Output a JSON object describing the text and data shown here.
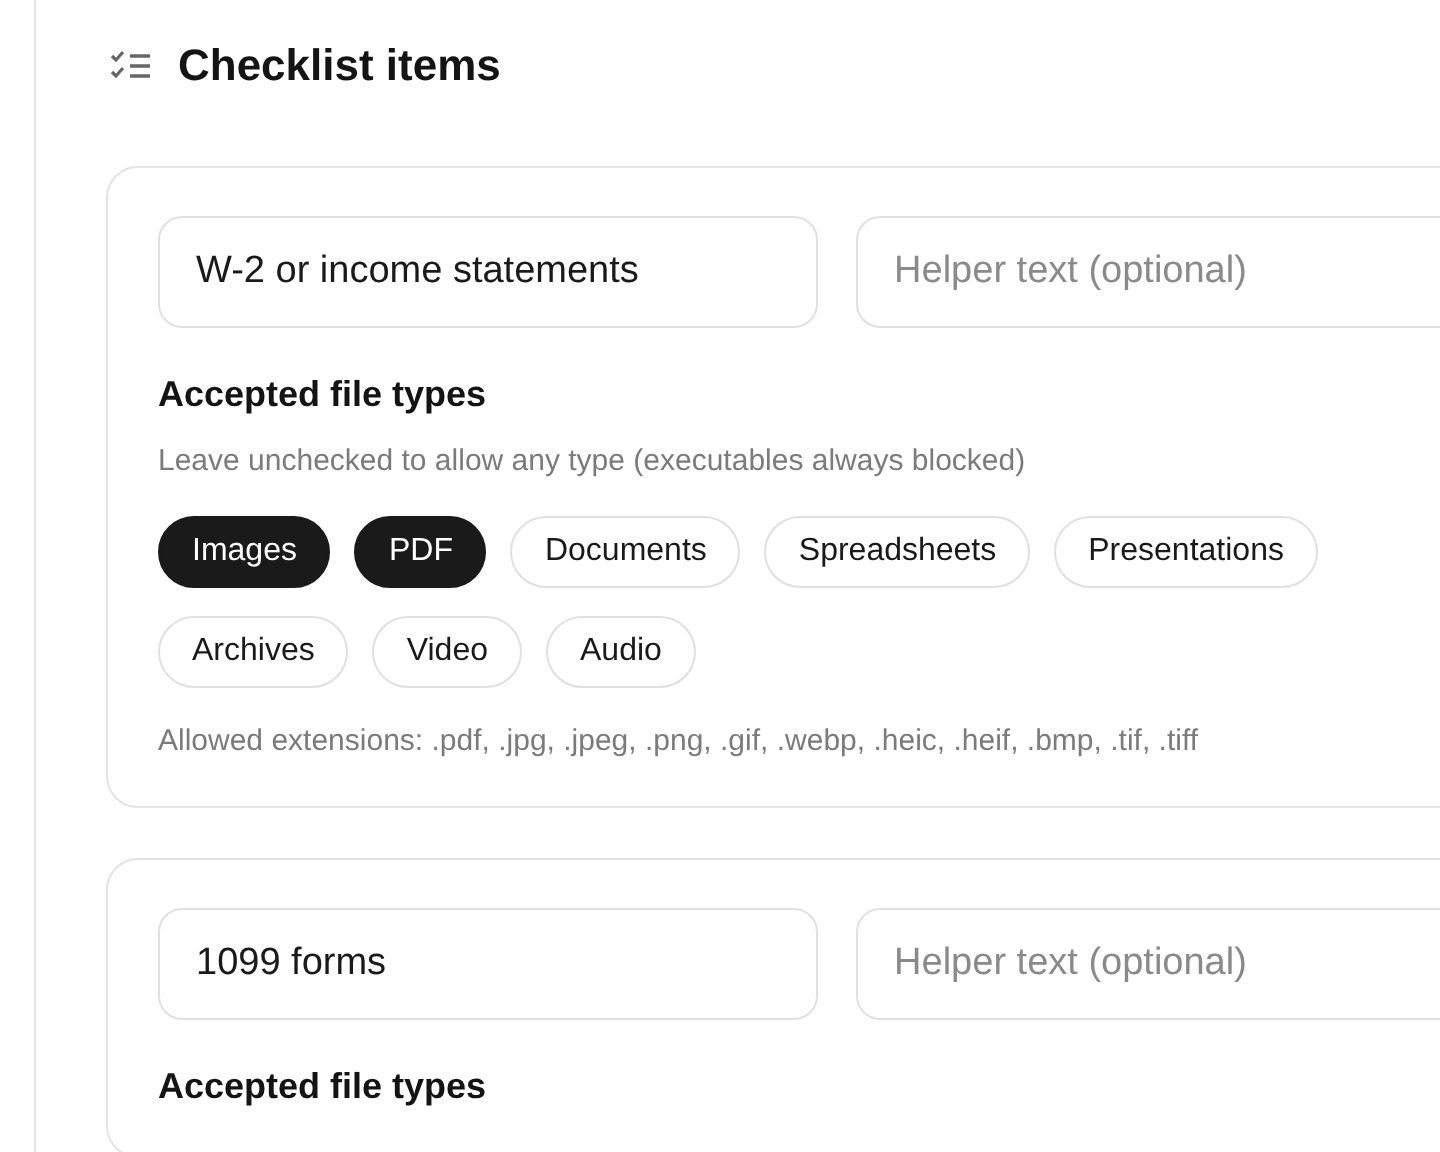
{
  "section": {
    "title": "Checklist items"
  },
  "items": [
    {
      "name": "W-2 or income statements",
      "helper_placeholder": "Helper text (optional)",
      "file_types_label": "Accepted file types",
      "file_types_hint": "Leave unchecked to allow any type (executables always blocked)",
      "file_types": [
        {
          "label": "Images",
          "selected": true
        },
        {
          "label": "PDF",
          "selected": true
        },
        {
          "label": "Documents",
          "selected": false
        },
        {
          "label": "Spreadsheets",
          "selected": false
        },
        {
          "label": "Presentations",
          "selected": false
        },
        {
          "label": "Archives",
          "selected": false
        },
        {
          "label": "Video",
          "selected": false
        },
        {
          "label": "Audio",
          "selected": false
        }
      ],
      "allowed_extensions": "Allowed extensions: .pdf, .jpg, .jpeg, .png, .gif, .webp, .heic, .heif, .bmp, .tif, .tiff"
    },
    {
      "name": "1099 forms",
      "helper_placeholder": "Helper text (optional)",
      "file_types_label": "Accepted file types"
    }
  ]
}
